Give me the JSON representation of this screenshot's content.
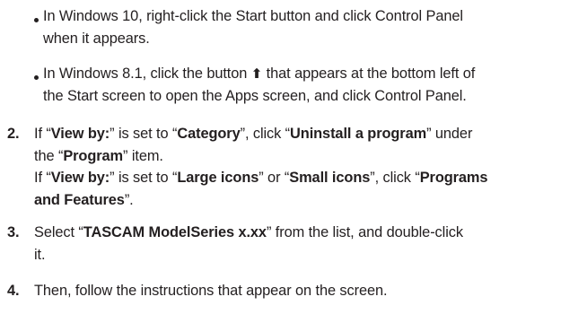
{
  "bullets": [
    {
      "line1": "In Windows 10, right-click the Start button and click Control Panel",
      "line2": "when it appears."
    },
    {
      "line1_a": "In Windows 8.1, click the button ",
      "icon_glyph": "⬆",
      "line1_b": " that appears at the bottom left of",
      "line2": "the Start screen to open the Apps screen, and click Control Panel."
    }
  ],
  "steps": [
    {
      "number": "2.",
      "l1_a": "If “",
      "l1_b": "View by:",
      "l1_c": "” is set to “",
      "l1_d": "Category",
      "l1_e": "”, click “",
      "l1_f": "Uninstall a program",
      "l1_g": "” under",
      "l2_a": "the “",
      "l2_b": "Program",
      "l2_c": "” item.",
      "l3_a": "If “",
      "l3_b": "View by:",
      "l3_c": "” is set to “",
      "l3_d": "Large icons",
      "l3_e": "” or “",
      "l3_f": "Small icons",
      "l3_g": "”, click “",
      "l3_h": "Programs",
      "l4_a": "and Features",
      "l4_b": "”."
    },
    {
      "number": "3.",
      "l1_a": "Select “",
      "l1_b": "TASCAM ModelSeries x.xx",
      "l1_c": "” from the list, and double-click",
      "l2": "it."
    },
    {
      "number": "4.",
      "l1": "Then, follow the instructions that appear on the screen."
    }
  ]
}
